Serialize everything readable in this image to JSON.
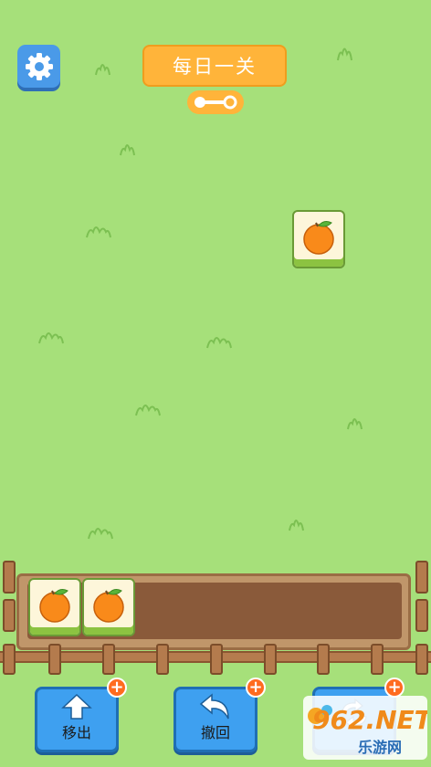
{
  "header": {
    "title": "每日一关"
  },
  "tiles": {
    "board": [
      "orange-tile"
    ],
    "tray": [
      "orange-tile",
      "orange-tile"
    ]
  },
  "buttons": {
    "move_out": "移出",
    "undo": "撤回",
    "plus": "+"
  },
  "watermark": {
    "logo_text": "962.NET",
    "sub_text": "乐游网"
  },
  "colors": {
    "grass": "#a6e07a",
    "banner": "#ffb43a",
    "button_blue": "#3ea0f0",
    "badge_orange": "#ff6b1f"
  }
}
